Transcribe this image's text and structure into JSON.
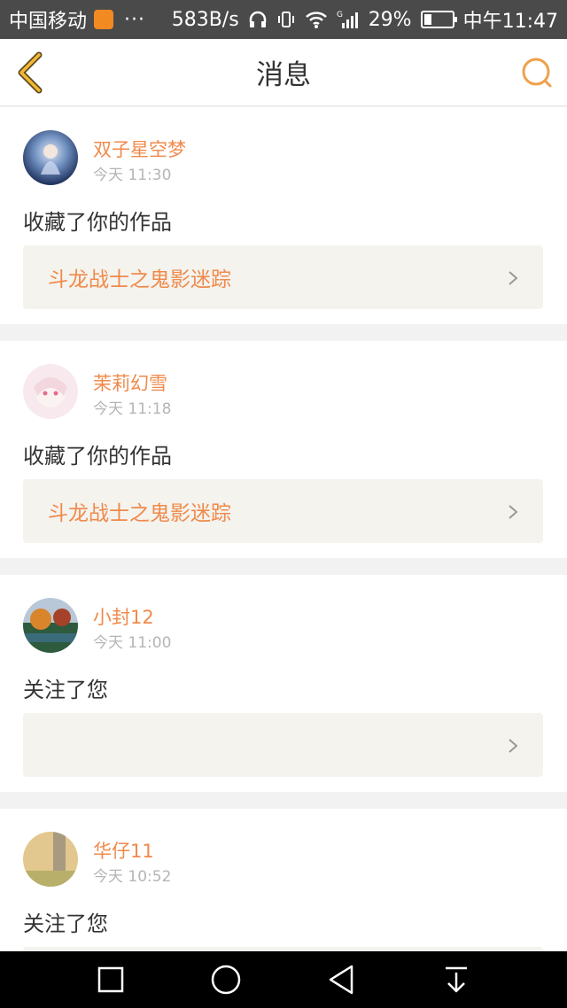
{
  "status_bar": {
    "carrier": "中国移动",
    "dots": "···",
    "speed": "583B/s",
    "battery": "29%",
    "time": "中午11:47",
    "battery_level": 0.29,
    "icons": [
      "app-icon",
      "headphones-icon",
      "vibrate-icon",
      "wifi-icon",
      "signal-icon",
      "battery-icon"
    ]
  },
  "header": {
    "title": "消息",
    "back_icon": "chevron-left-icon",
    "search_icon": "search-icon",
    "accent": "#f0a04b"
  },
  "messages": [
    {
      "name": "双子星空梦",
      "time": "今天 11:30",
      "action": "收藏了你的作品",
      "work": "斗龙战士之鬼影迷踪"
    },
    {
      "name": "茉莉幻雪",
      "time": "今天 11:18",
      "action": "收藏了你的作品",
      "work": "斗龙战士之鬼影迷踪"
    },
    {
      "name": "小封12",
      "time": "今天 11:00",
      "action": "关注了您",
      "work": ""
    },
    {
      "name": "华仔11",
      "time": "今天 10:52",
      "action": "关注了您",
      "work": ""
    }
  ],
  "system_nav": [
    "recent-apps-icon",
    "home-icon",
    "back-icon",
    "notification-pull-icon"
  ],
  "colors": {
    "accent_text": "#f08a4b",
    "card_bg": "#f4f3ee"
  }
}
